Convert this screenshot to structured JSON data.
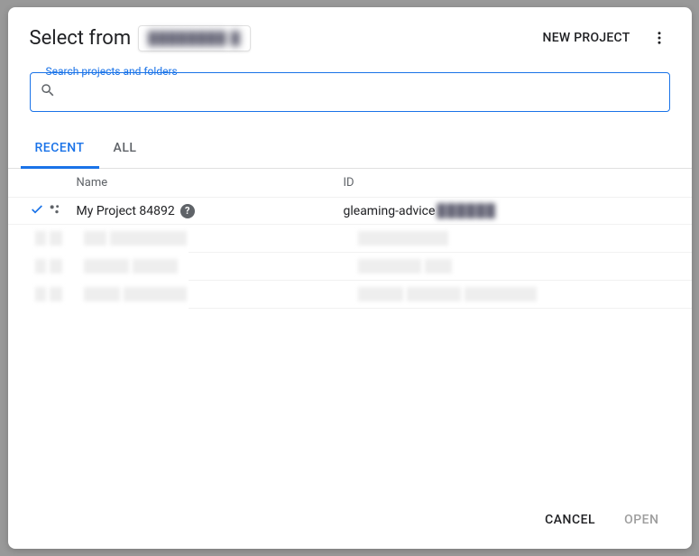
{
  "header": {
    "title_prefix": "Select from",
    "org_name_redacted": "████████ █",
    "new_project_label": "NEW PROJECT"
  },
  "search": {
    "label": "Search projects and folders",
    "placeholder": "",
    "value": ""
  },
  "tabs": {
    "recent": "RECENT",
    "all": "ALL",
    "active": "recent"
  },
  "columns": {
    "name": "Name",
    "id": "ID"
  },
  "rows": [
    {
      "selected": true,
      "name": "My Project 84892",
      "id_visible": "gleaming-advice",
      "id_redacted": "██████",
      "has_help": true
    }
  ],
  "footer": {
    "cancel": "CANCEL",
    "open": "OPEN"
  }
}
